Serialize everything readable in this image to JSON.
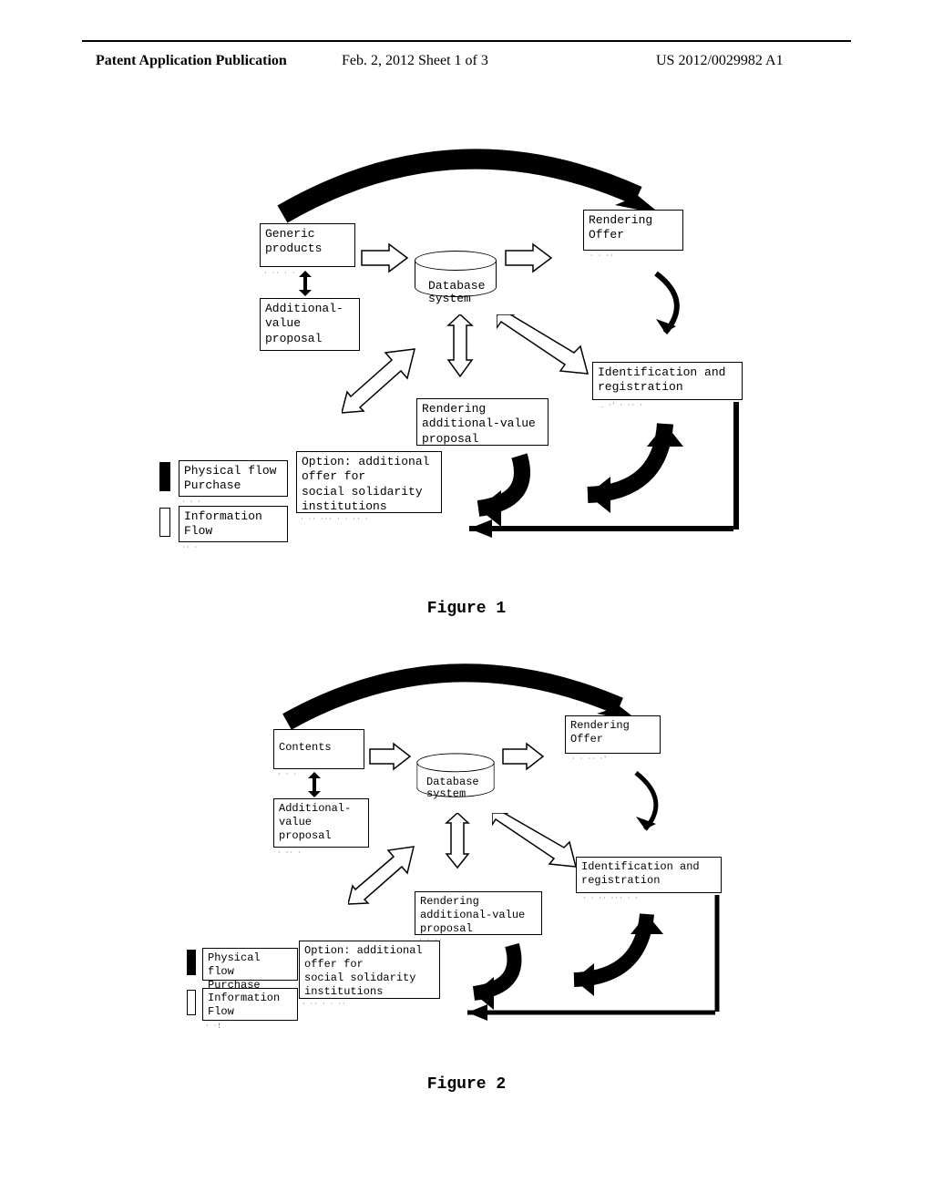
{
  "header": {
    "left": "Patent Application Publication",
    "center": "Feb. 2, 2012  Sheet 1 of 3",
    "right": "US 2012/0029982 A1"
  },
  "figure1": {
    "caption": "Figure 1",
    "boxes": {
      "generic_products": "Generic\nproducts",
      "additional_value": "Additional-\nvalue\nproposal",
      "database": "Database\nsystem",
      "rendering_offer": "Rendering\nOffer",
      "identification": "Identification and\nregistration",
      "rendering_avp": "Rendering\nadditional-value\nproposal",
      "option": "Option: additional\noffer for\nsocial solidarity\ninstitutions",
      "legend_physical": "Physical flow\nPurchase",
      "legend_info": "Information\nFlow"
    }
  },
  "figure2": {
    "caption": "Figure 2",
    "boxes": {
      "contents": "Contents",
      "additional_value": "Additional-\nvalue\nproposal",
      "database": "Database\nsystem",
      "rendering_offer": "Rendering\nOffer",
      "identification": "Identification and\nregistration",
      "rendering_avp": "Rendering\nadditional-value\nproposal",
      "option": "Option: additional\noffer for\nsocial solidarity\ninstitutions",
      "legend_physical": "Physical flow\nPurchase",
      "legend_info": "Information\nFlow"
    }
  }
}
